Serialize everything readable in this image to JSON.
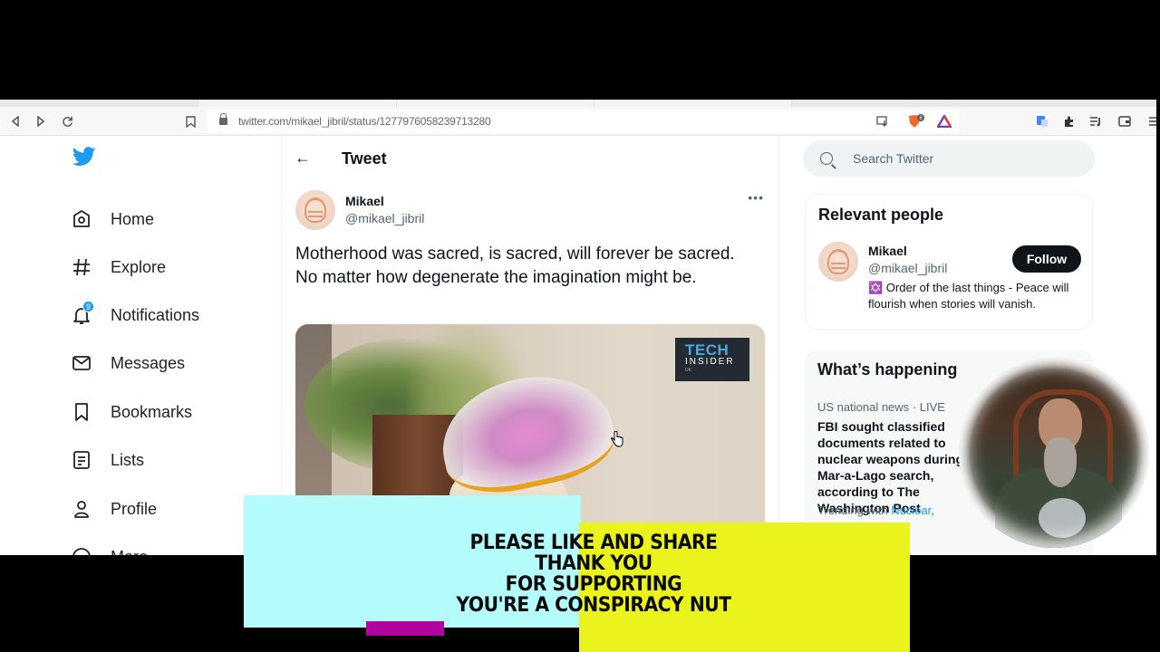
{
  "browser": {
    "url": "twitter.com/mikael_jibril/status/1277976058239713280",
    "nav_icons": [
      "back-icon",
      "forward-icon",
      "reload-icon",
      "bookmark-icon"
    ],
    "right_icons": [
      "install-app-icon",
      "brave-shields-icon",
      "brave-rewards-icon",
      "translate-icon",
      "extensions-icon",
      "playlist-icon",
      "wallet-icon",
      "menu-icon"
    ],
    "shields_count": "8"
  },
  "sidebar": {
    "logo": "twitter-bird-icon",
    "items": [
      {
        "label": "Home",
        "icon": "home-icon"
      },
      {
        "label": "Explore",
        "icon": "hashtag-icon"
      },
      {
        "label": "Notifications",
        "icon": "bell-icon",
        "badge": "9"
      },
      {
        "label": "Messages",
        "icon": "envelope-icon"
      },
      {
        "label": "Bookmarks",
        "icon": "bookmark-icon"
      },
      {
        "label": "Lists",
        "icon": "list-icon"
      },
      {
        "label": "Profile",
        "icon": "person-icon"
      },
      {
        "label": "More",
        "icon": "more-circle-icon"
      }
    ]
  },
  "main": {
    "title": "Tweet",
    "tweet": {
      "author_name": "Mikael",
      "author_handle": "@mikael_jibril",
      "text": "Motherhood was sacred, is sacred, will forever be sacred. No matter how degenerate the imagination might be.",
      "media_watermark": {
        "line1": "TECH",
        "line2": "INSIDER",
        "line3": "UK"
      }
    }
  },
  "right": {
    "search_placeholder": "Search Twitter",
    "relevant": {
      "title": "Relevant people",
      "name": "Mikael",
      "handle": "@mikael_jibril",
      "bio": "✡️ Order of the last things - Peace will flourish when stories will vanish.",
      "follow_label": "Follow"
    },
    "happening": {
      "title": "What’s happening",
      "meta": "US national news · LIVE",
      "headline": "FBI sought classified documents related to nuclear weapons during Mar-a-Lago search, according to The Washington Post",
      "trending_prefix": "Trending with",
      "trending_link": "Nuclear",
      "trending_suffix": ","
    }
  },
  "overlay": {
    "banner_lines": [
      "PLEASE LIKE AND SHARE",
      "THANK YOU",
      "FOR SUPPORTING",
      "YOU'RE A CONSPIRACY NUT"
    ],
    "colors": {
      "cyan": "#b4fcfb",
      "yellow": "#eaf31b",
      "magenta": "#b1049e"
    }
  }
}
